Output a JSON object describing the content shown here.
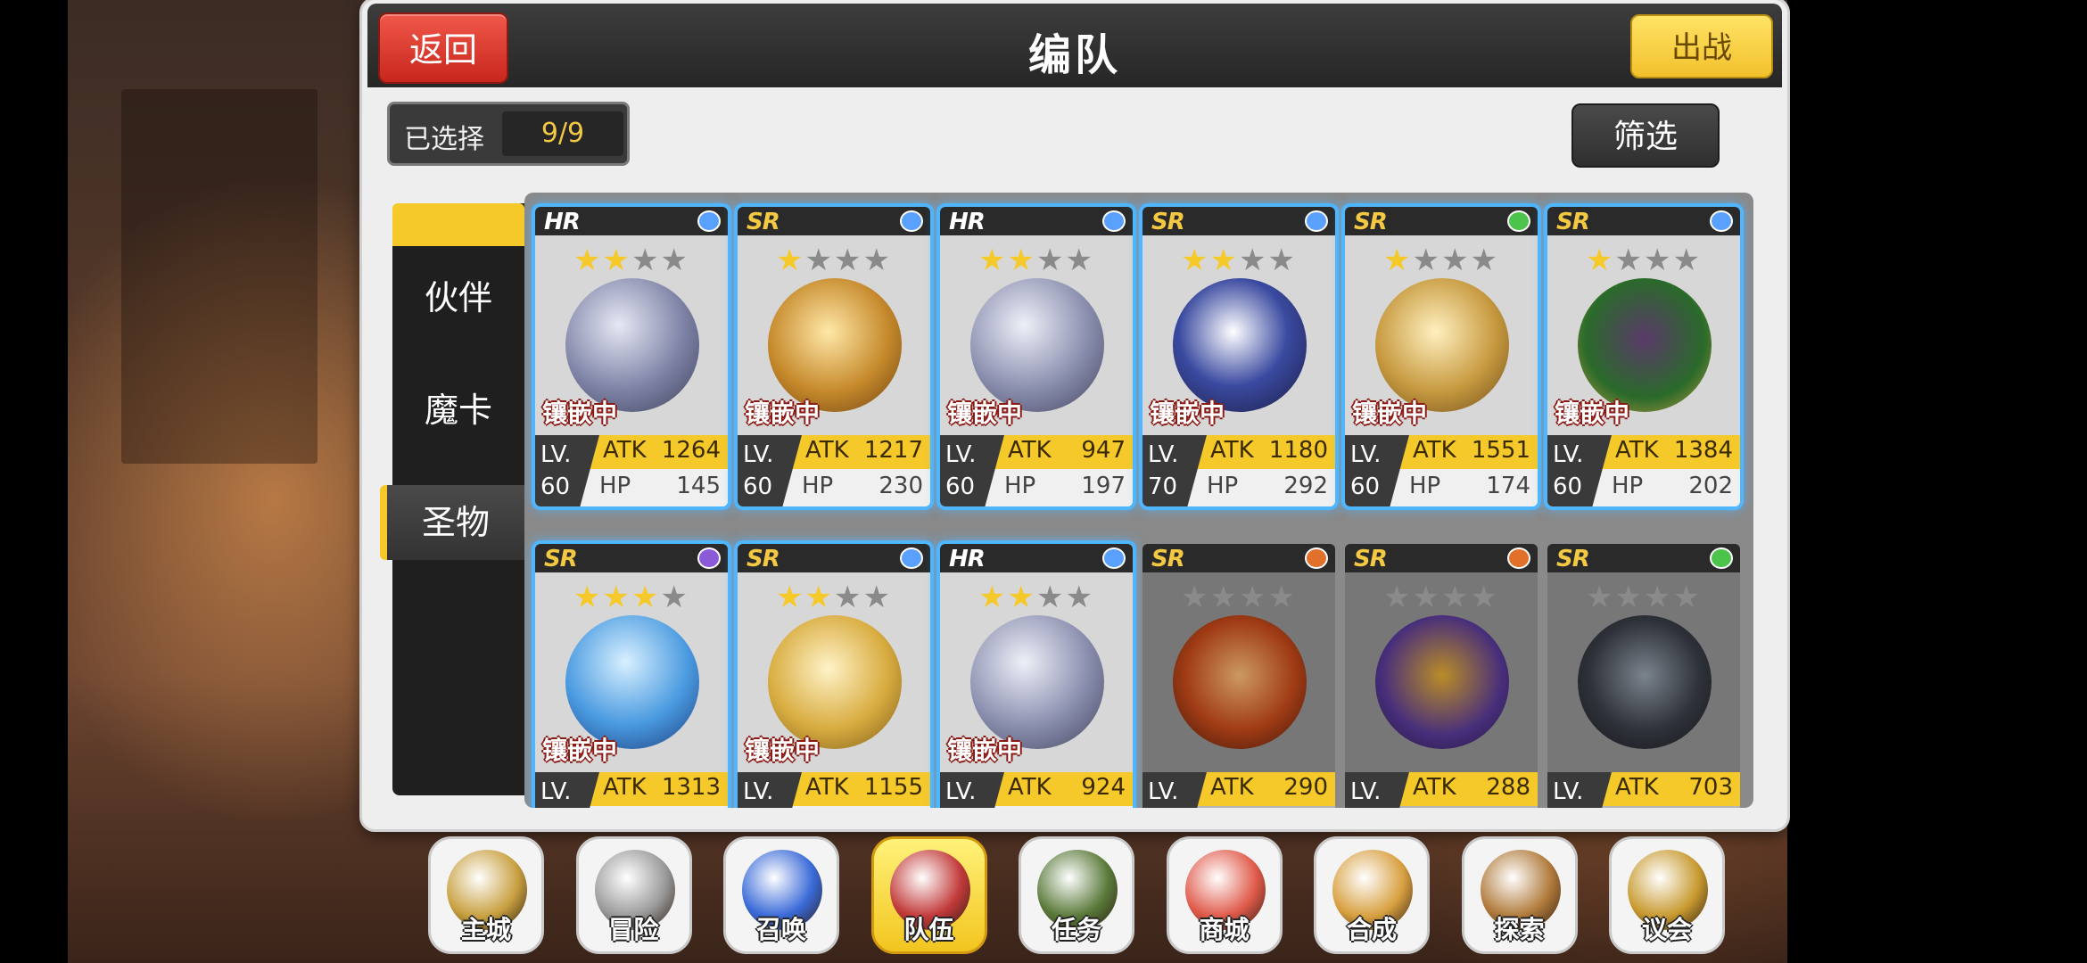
{
  "header": {
    "title": "编队",
    "back_label": "返回",
    "battle_label": "出战"
  },
  "selection": {
    "label": "已选择",
    "count": "9/9"
  },
  "filter_label": "筛选",
  "tabs": [
    {
      "label": "伙伴"
    },
    {
      "label": "魔卡"
    },
    {
      "label": "圣物"
    }
  ],
  "active_tab": "圣物",
  "embed_label": "镶嵌中",
  "lv_label": "LV.",
  "atk_label": "ATK",
  "hp_label": "HP",
  "cards": [
    {
      "rarity": "HR",
      "stars": 2,
      "lv": "60",
      "atk": "1264",
      "hp": "145",
      "embedded": true,
      "elem_color": "#5aa0ff",
      "art": "silver-beast-relic"
    },
    {
      "rarity": "SR",
      "stars": 1,
      "lv": "60",
      "atk": "1217",
      "hp": "230",
      "embedded": true,
      "elem_color": "#5aa0ff",
      "art": "golden-lyre-relic"
    },
    {
      "rarity": "HR",
      "stars": 2,
      "lv": "60",
      "atk": "947",
      "hp": "197",
      "embedded": true,
      "elem_color": "#5aa0ff",
      "art": "silver-wolf-relic"
    },
    {
      "rarity": "SR",
      "stars": 2,
      "lv": "70",
      "atk": "1180",
      "hp": "292",
      "embedded": true,
      "elem_color": "#5aa0ff",
      "art": "scroll-crest-relic"
    },
    {
      "rarity": "SR",
      "stars": 1,
      "lv": "60",
      "atk": "1551",
      "hp": "174",
      "embedded": true,
      "elem_color": "#4cc44c",
      "art": "winged-wheel-relic"
    },
    {
      "rarity": "SR",
      "stars": 1,
      "lv": "60",
      "atk": "1384",
      "hp": "202",
      "embedded": true,
      "elem_color": "#5aa0ff",
      "art": "christmas-wreath-relic"
    },
    {
      "rarity": "SR",
      "stars": 3,
      "lv": "",
      "atk": "1313",
      "hp": "",
      "embedded": true,
      "elem_color": "#8a5ad8",
      "art": "blue-spirit-lion-relic"
    },
    {
      "rarity": "SR",
      "stars": 2,
      "lv": "",
      "atk": "1155",
      "hp": "",
      "embedded": true,
      "elem_color": "#5aa0ff",
      "art": "golden-telescope-relic"
    },
    {
      "rarity": "HR",
      "stars": 2,
      "lv": "",
      "atk": "924",
      "hp": "",
      "embedded": true,
      "elem_color": "#5aa0ff",
      "art": "silver-wolf-relic"
    },
    {
      "rarity": "SR",
      "stars": 0,
      "lv": "",
      "atk": "290",
      "hp": "",
      "embedded": false,
      "elem_color": "#e0702a",
      "art": "flaming-cross-relic"
    },
    {
      "rarity": "SR",
      "stars": 0,
      "lv": "",
      "atk": "288",
      "hp": "",
      "embedded": false,
      "elem_color": "#e0702a",
      "art": "golden-lion-relic"
    },
    {
      "rarity": "SR",
      "stars": 0,
      "lv": "",
      "atk": "703",
      "hp": "",
      "embedded": false,
      "elem_color": "#4cc44c",
      "art": "mechanical-crest-relic"
    }
  ],
  "nav": [
    {
      "label": "主城",
      "icon": "crown-icon",
      "color": "#c8a040"
    },
    {
      "label": "冒险",
      "icon": "crossed-weapons-icon",
      "color": "#9a9a9a"
    },
    {
      "label": "召唤",
      "icon": "summon-card-icon",
      "color": "#3a6ad8"
    },
    {
      "label": "队伍",
      "icon": "team-shield-icon",
      "color": "#c23a3a",
      "active": true
    },
    {
      "label": "任务",
      "icon": "quest-book-icon",
      "color": "#5a7a3a"
    },
    {
      "label": "商城",
      "icon": "shop-tree-icon",
      "color": "#e05a4a"
    },
    {
      "label": "合成",
      "icon": "potion-icon",
      "color": "#d8a040"
    },
    {
      "label": "探索",
      "icon": "compass-icon",
      "color": "#b07a3a"
    },
    {
      "label": "议会",
      "icon": "council-crest-icon",
      "color": "#c89a30"
    }
  ]
}
